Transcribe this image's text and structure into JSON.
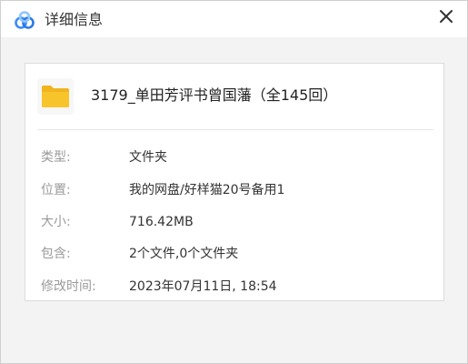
{
  "window": {
    "title": "详细信息",
    "logo_icon": "cloud-logo-icon",
    "close_icon": "close-icon"
  },
  "item": {
    "icon": "folder-icon",
    "name": "3179_单田芳评书曾国藩（全145回）"
  },
  "details": [
    {
      "label": "类型:",
      "value": "文件夹"
    },
    {
      "label": "位置:",
      "value": "我的网盘/好样猫20号备用1"
    },
    {
      "label": "大小:",
      "value": "716.42MB"
    },
    {
      "label": "包含:",
      "value": "2个文件,0个文件夹"
    },
    {
      "label": "修改时间:",
      "value": "2023年07月11日, 18:54"
    }
  ],
  "colors": {
    "logo_blue": "#3b8cf7",
    "logo_light": "#8ec5ff",
    "folder_yellow": "#f8c42c",
    "label_gray": "#9a9a9a",
    "text_dark": "#333333"
  }
}
